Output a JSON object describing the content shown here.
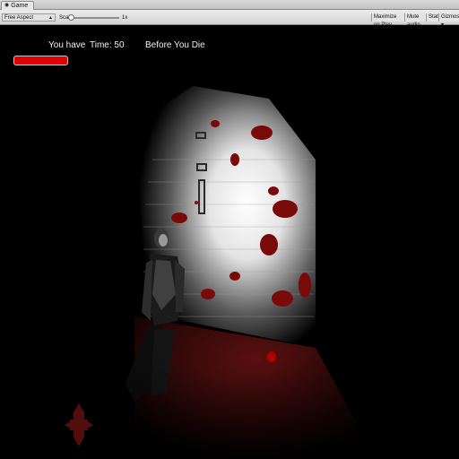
{
  "window": {
    "tab_label": "Game",
    "tab_icon": "gamepad-icon"
  },
  "toolbar": {
    "aspect_label": "Free Aspect",
    "scale_label": "Scale",
    "scale_value": "1x",
    "scale_level": 0.0,
    "buttons": [
      "Maximize on Play",
      "Mute audio",
      "Stats",
      "Gizmos ▾"
    ]
  },
  "hud": {
    "you_have": "You have",
    "time": "Time: 50",
    "before_die": "Before You Die",
    "health_fraction": 1.0,
    "health_color": "#e00000"
  },
  "scene": {
    "background": "#000000",
    "blood_color": "#8b0000"
  }
}
